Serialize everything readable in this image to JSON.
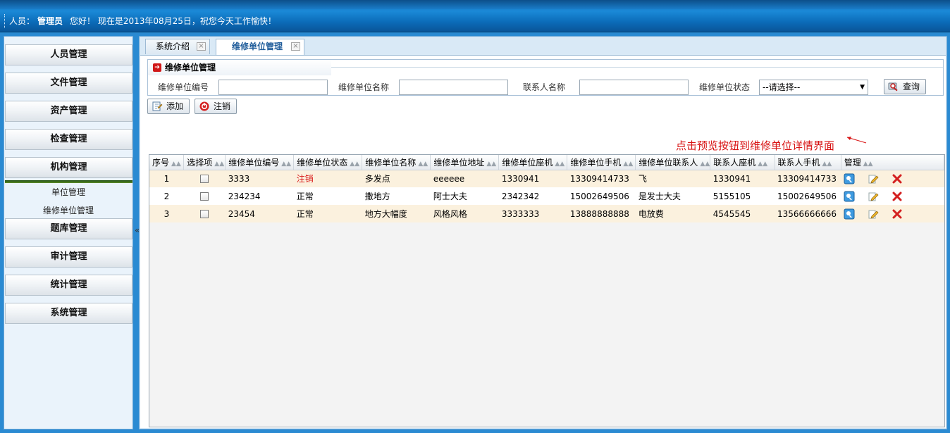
{
  "header": {
    "user_label": "人员：",
    "user_name": "管理员",
    "greeting": "您好！ 现在是2013年08月25日，祝您今天工作愉快！"
  },
  "sidebar": {
    "items": [
      {
        "label": "人员管理"
      },
      {
        "label": "文件管理"
      },
      {
        "label": "资产管理"
      },
      {
        "label": "检查管理"
      },
      {
        "label": "机构管理"
      },
      {
        "label": "题库管理"
      },
      {
        "label": "审计管理"
      },
      {
        "label": "统计管理"
      },
      {
        "label": "系统管理"
      }
    ],
    "subitems": [
      "单位管理",
      "维修单位管理"
    ],
    "collapse_glyph": "«"
  },
  "tabs": [
    {
      "label": "系统介绍"
    },
    {
      "label": "维修单位管理"
    }
  ],
  "query": {
    "title": "维修单位管理",
    "labels": [
      "维修单位编号",
      "维修单位名称",
      "联系人名称",
      "维修单位状态"
    ],
    "values": [
      "",
      "",
      ""
    ],
    "status_selected": "--请选择--",
    "search_label": "查询"
  },
  "toolbar": {
    "add_label": "添加",
    "cancel_label": "注销"
  },
  "annotation": "点击预览按钮到维修单位详情界面",
  "grid": {
    "columns": [
      "序号",
      "选择项",
      "维修单位编号",
      "维修单位状态",
      "维修单位名称",
      "维修单位地址",
      "维修单位座机",
      "维修单位手机",
      "维修单位联系人",
      "联系人座机",
      "联系人手机",
      "管理"
    ],
    "rows": [
      {
        "no": "1",
        "code": "3333",
        "status": "注销",
        "name": "多发点",
        "addr": "eeeeee",
        "tel": "1330941",
        "mobile": "13309414733",
        "contact": "飞",
        "ctel": "1330941",
        "cmobile": "13309414733"
      },
      {
        "no": "2",
        "code": "234234",
        "status": "正常",
        "name": "撒地方",
        "addr": "阿士大夫",
        "tel": "2342342",
        "mobile": "15002649506",
        "contact": "是发士大夫",
        "ctel": "5155105",
        "cmobile": "15002649506"
      },
      {
        "no": "3",
        "code": "23454",
        "status": "正常",
        "name": "地方大幅度",
        "addr": "风格风格",
        "tel": "3333333",
        "mobile": "13888888888",
        "contact": "电放费",
        "ctel": "4545545",
        "cmobile": "13566666666"
      }
    ]
  },
  "colors": {
    "accent": "#1b8ad8",
    "annotation": "#d81414",
    "stripe": "#fbf1de"
  },
  "icons": [
    "preview-icon",
    "edit-icon",
    "delete-icon",
    "add-icon",
    "cancel-icon",
    "search-icon",
    "arrow-icon"
  ]
}
